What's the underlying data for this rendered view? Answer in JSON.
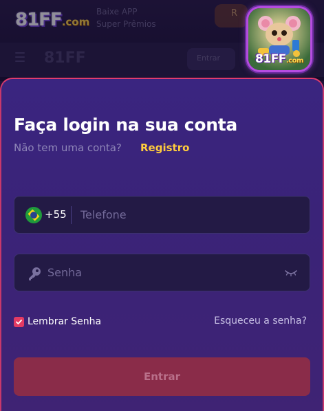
{
  "brand": {
    "name": "81FF",
    "suffix": ".com"
  },
  "background": {
    "promo_line_1": "Baixe APP",
    "promo_line_2": "Super Prêmios",
    "promo_button": "R",
    "nav_logo": "81FF",
    "nav_pill": "Entrar"
  },
  "app_icon": {
    "name": "81FF",
    "suffix": ".com"
  },
  "login": {
    "title": "Faça login na sua conta",
    "subtitle": "Não tem uma conta?",
    "register_link": "Registro",
    "phone": {
      "country_code": "+55",
      "placeholder": "Telefone",
      "flag": "brazil-flag"
    },
    "password": {
      "placeholder": "Senha"
    },
    "remember_label": "Lembrar Senha",
    "remember_checked": true,
    "forgot_link": "Esqueceu a senha?",
    "submit_label": "Entrar"
  },
  "colors": {
    "sheet_bg": "#3a2580",
    "accent_border": "#e03c6e",
    "link_yellow": "#ffcc3d",
    "button_bg": "#8a2c49",
    "checkbox": "#e33b63"
  }
}
